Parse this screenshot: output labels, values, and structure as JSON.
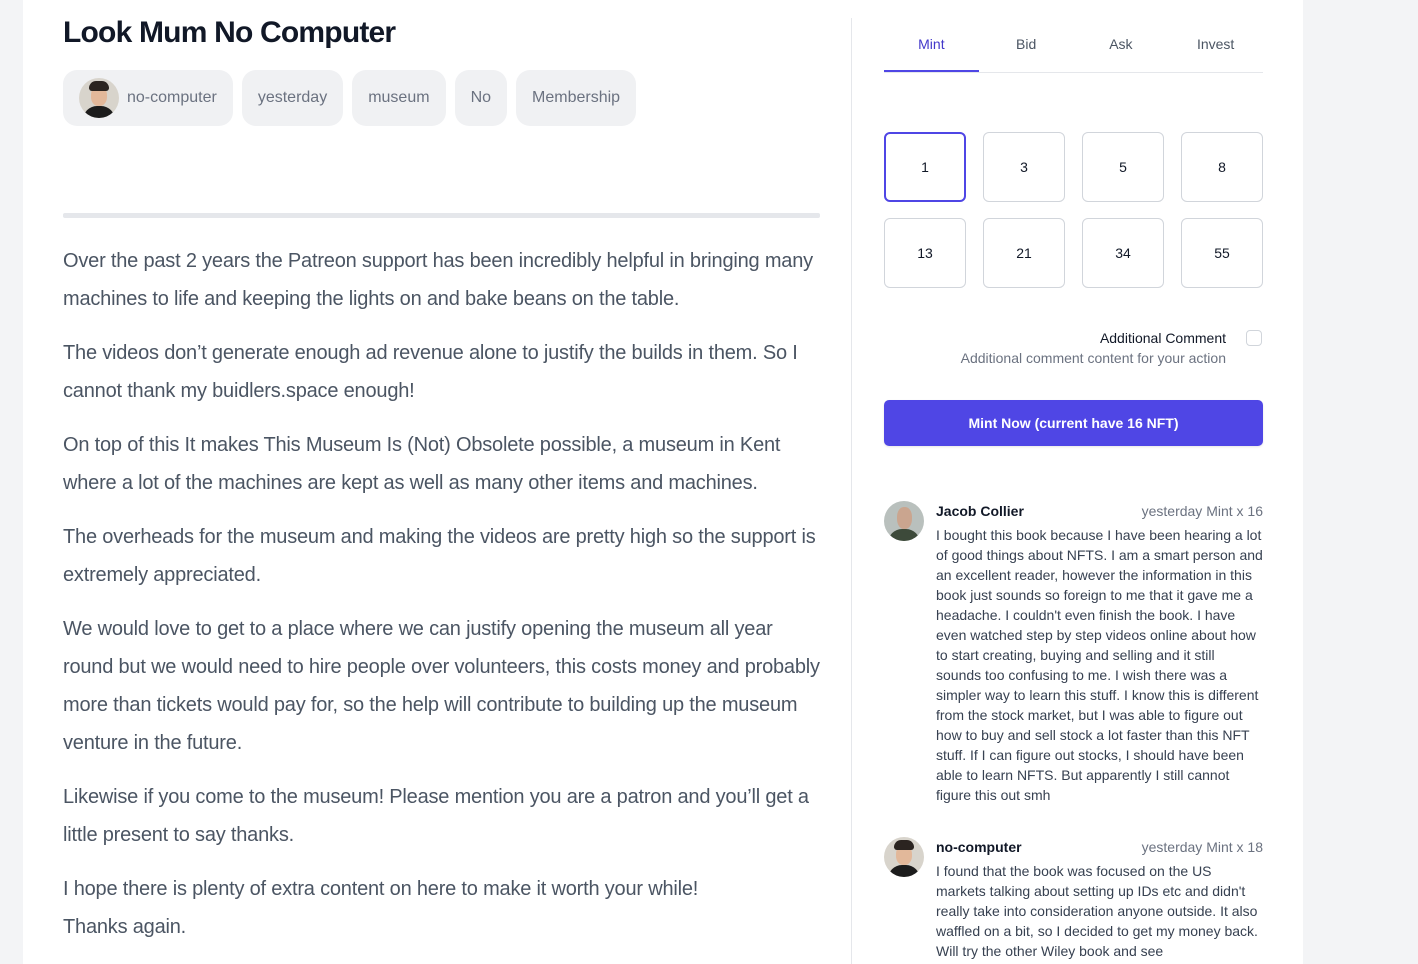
{
  "post": {
    "title": "Look Mum No Computer",
    "tags": {
      "author": "no-computer",
      "date": "yesterday",
      "category": "museum",
      "flag": "No",
      "type": "Membership"
    },
    "paragraphs": [
      "Over the past 2 years the Patreon support has been incredibly helpful in bringing many machines to life and keeping the lights on and bake beans on the table.",
      "The videos don’t generate enough ad revenue alone to justify the builds in them. So I cannot thank my buidlers.space enough!",
      "On top of this It makes This Museum Is (Not) Obsolete possible, a museum in Kent where a lot of the machines are kept as well as many other items and machines.",
      "The overheads for the museum and making the videos are pretty high so the support is extremely appreciated.",
      "We would love to get to a place where we can justify opening the museum all year round but we would need to hire people over volunteers, this costs money and probably more than tickets would pay for, so the help will contribute to building up the museum venture in the future.",
      "Likewise if you come to the museum! Please mention you are a patron and you’ll get a little present to say thanks.",
      "I hope there is plenty of extra content on here to make it worth your while!",
      "Thanks again."
    ]
  },
  "panel": {
    "tabs": [
      "Mint",
      "Bid",
      "Ask",
      "Invest"
    ],
    "active_tab": "Mint",
    "quantities": [
      "1",
      "3",
      "5",
      "8",
      "13",
      "21",
      "34",
      "55"
    ],
    "selected_quantity": "1",
    "comment_label": "Additional Comment",
    "comment_description": "Additional comment content for your action",
    "comment_checked": false,
    "mint_button": "Mint Now (current have 16 NFT)",
    "accent_color": "#4f46e5"
  },
  "reviews": [
    {
      "name": "Jacob Collier",
      "meta": "yesterday Mint x 16",
      "text": "I bought this book because I have been hearing a lot of good things about NFTS. I am a smart person and an excellent reader, however the information in this book just sounds so foreign to me that it gave me a headache. I couldn't even finish the book. I have even watched step by step videos online about how to start creating, buying and selling and it still sounds too confusing to me. I wish there was a simpler way to learn this stuff. I know this is different from the stock market, but I was able to figure out how to buy and sell stock a lot faster than this NFT stuff. If I can figure out stocks, I should have been able to learn NFTS. But apparently I still cannot figure this out smh"
    },
    {
      "name": "no-computer",
      "meta": "yesterday Mint x 18",
      "text": "I found that the book was focused on the US markets talking about setting up IDs etc and didn't really take into consideration anyone outside. It also waffled on a bit, so I decided to get my money back. Will try the other Wiley book and see"
    }
  ]
}
